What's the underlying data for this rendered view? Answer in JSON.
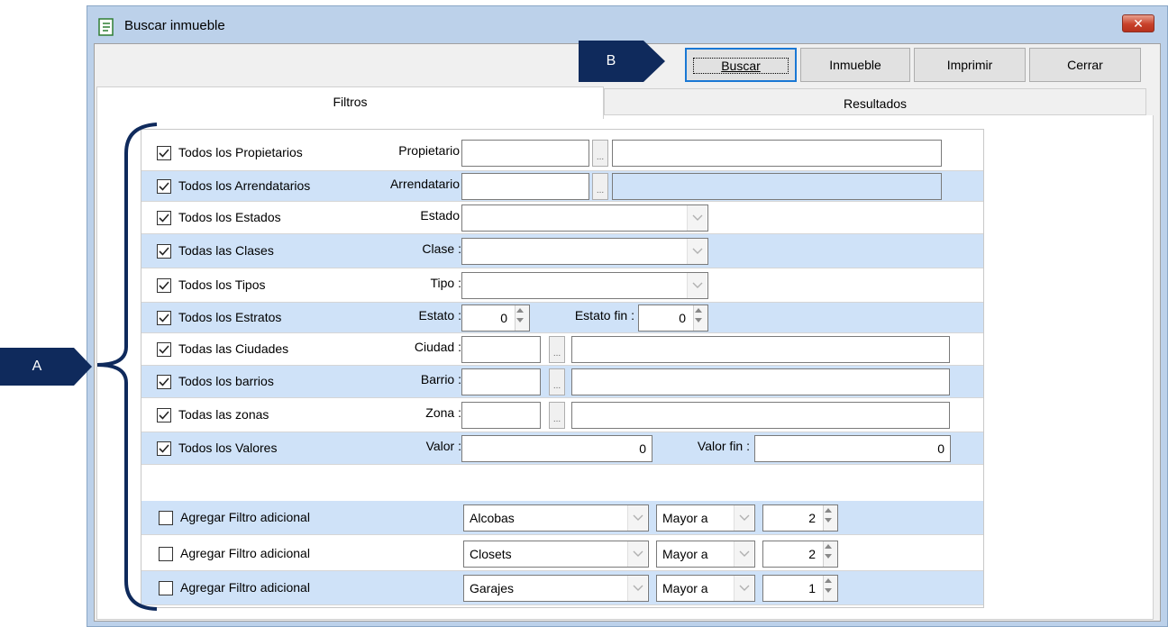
{
  "window": {
    "title": "Buscar inmueble",
    "close_glyph": "✕"
  },
  "toolbar": {
    "buttons": [
      "Buscar",
      "Inmueble",
      "Imprimir",
      "Cerrar"
    ]
  },
  "tabs": [
    "Filtros",
    "Resultados"
  ],
  "filters": [
    {
      "check_label": "Todos los Propietarios",
      "checked": true,
      "field_label": "Propietario"
    },
    {
      "check_label": "Todos los Arrendatarios",
      "checked": true,
      "field_label": "Arrendatario"
    },
    {
      "check_label": "Todos los Estados",
      "checked": true,
      "field_label": "Estado"
    },
    {
      "check_label": "Todas las Clases",
      "checked": true,
      "field_label": "Clase :"
    },
    {
      "check_label": "Todos los Tipos",
      "checked": true,
      "field_label": "Tipo :"
    },
    {
      "check_label": "Todos los Estratos",
      "checked": true,
      "field_label": "Estato :",
      "value": "0",
      "end_label": "Estato fin :",
      "end_value": "0"
    },
    {
      "check_label": "Todas las Ciudades",
      "checked": true,
      "field_label": "Ciudad :"
    },
    {
      "check_label": "Todos los barrios",
      "checked": true,
      "field_label": "Barrio :"
    },
    {
      "check_label": "Todas las zonas",
      "checked": true,
      "field_label": "Zona :"
    },
    {
      "check_label": "Todos los Valores",
      "checked": true,
      "field_label": "Valor :",
      "value": "0",
      "end_label": "Valor fin :",
      "end_value": "0"
    }
  ],
  "extra_filters": [
    {
      "check_label": "Agregar Filtro adicional",
      "checked": false,
      "field": "Alcobas",
      "operator": "Mayor a",
      "amount": "2"
    },
    {
      "check_label": "Agregar Filtro adicional",
      "checked": false,
      "field": "Closets",
      "operator": "Mayor a",
      "amount": "2"
    },
    {
      "check_label": "Agregar Filtro adicional",
      "checked": false,
      "field": "Garajes",
      "operator": "Mayor a",
      "amount": "1"
    }
  ],
  "ellipsis": "...",
  "annotations": {
    "a": "A",
    "b": "B"
  },
  "colors": {
    "row_alt": "#cfe2f8",
    "callout": "#0f2a5c",
    "default_button_border": "#1a78d4"
  },
  "icons": {
    "app": "app-form-icon",
    "close": "close-icon",
    "combo": "chevron-down-icon",
    "spin": "spin-arrows-icon",
    "check": "checkmark-icon"
  }
}
